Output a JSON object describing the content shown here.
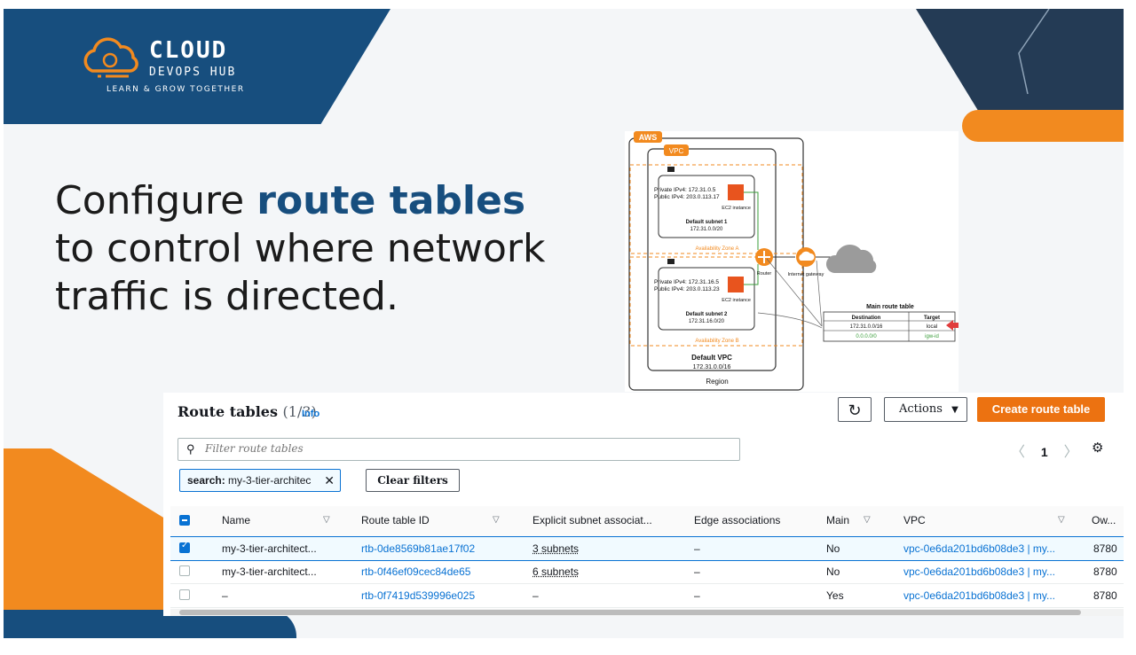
{
  "brand": {
    "title": "CLOUD",
    "subtitle": "DEVOPS HUB",
    "tagline": "LEARN & GROW TOGETHER"
  },
  "headline": {
    "pre": "Configure ",
    "highlight": "route tables",
    "post": " to control where network traffic is directed."
  },
  "diagram": {
    "aws": "AWS",
    "vpc": "VPC",
    "subnet1": {
      "private_ip": "Private IPv4: 172.31.0.5",
      "public_ip": "Public IPv4: 203.0.113.17",
      "instance": "EC2 instance",
      "name": "Default subnet 1",
      "cidr": "172.31.0.0/20",
      "az": "Availability Zone A"
    },
    "subnet2": {
      "private_ip": "Private IPv4: 172.31.16.5",
      "public_ip": "Public IPv4: 203.0.113.23",
      "instance": "EC2 instance",
      "name": "Default subnet 2",
      "cidr": "172.31.16.0/20",
      "az": "Availability Zone B"
    },
    "router": "Router",
    "igw": "Internet gateway",
    "default_vpc": "Default VPC",
    "default_vpc_cidr": "172.31.0.0/16",
    "region": "Region",
    "main_table": {
      "title": "Main route table",
      "headers": [
        "Destination",
        "Target"
      ],
      "rows": [
        [
          "172.31.0.0/16",
          "local"
        ],
        [
          "0.0.0.0/0",
          "igw-id"
        ]
      ]
    }
  },
  "console": {
    "title": "Route tables",
    "count": "(1/3)",
    "info": "Info",
    "actions": "Actions",
    "create": "Create route table",
    "filter_placeholder": "Filter route tables",
    "page": "1",
    "token_key": "search:",
    "token_value": "my-3-tier-architec",
    "clear_filters": "Clear filters",
    "columns": [
      "Name",
      "Route table ID",
      "Explicit subnet associat...",
      "Edge associations",
      "Main",
      "VPC",
      "Ow..."
    ],
    "rows": [
      {
        "name": "my-3-tier-architect...",
        "id": "rtb-0de8569b81ae17f02",
        "subnets": "3 subnets",
        "edge": "–",
        "main": "No",
        "vpc": "vpc-0e6da201bd6b08de3 | my...",
        "owner": "8780",
        "selected": true
      },
      {
        "name": "my-3-tier-architect...",
        "id": "rtb-0f46ef09cec84de65",
        "subnets": "6 subnets",
        "edge": "–",
        "main": "No",
        "vpc": "vpc-0e6da201bd6b08de3 | my...",
        "owner": "8780",
        "selected": false
      },
      {
        "name": "–",
        "id": "rtb-0f7419d539996e025",
        "subnets": "–",
        "edge": "–",
        "main": "Yes",
        "vpc": "vpc-0e6da201bd6b08de3 | my...",
        "owner": "8780",
        "selected": false
      }
    ]
  },
  "colors": {
    "brand_blue": "#174e7e",
    "brand_orange": "#f28a1f",
    "aws_orange": "#ec7211",
    "aws_link": "#0972d3"
  }
}
